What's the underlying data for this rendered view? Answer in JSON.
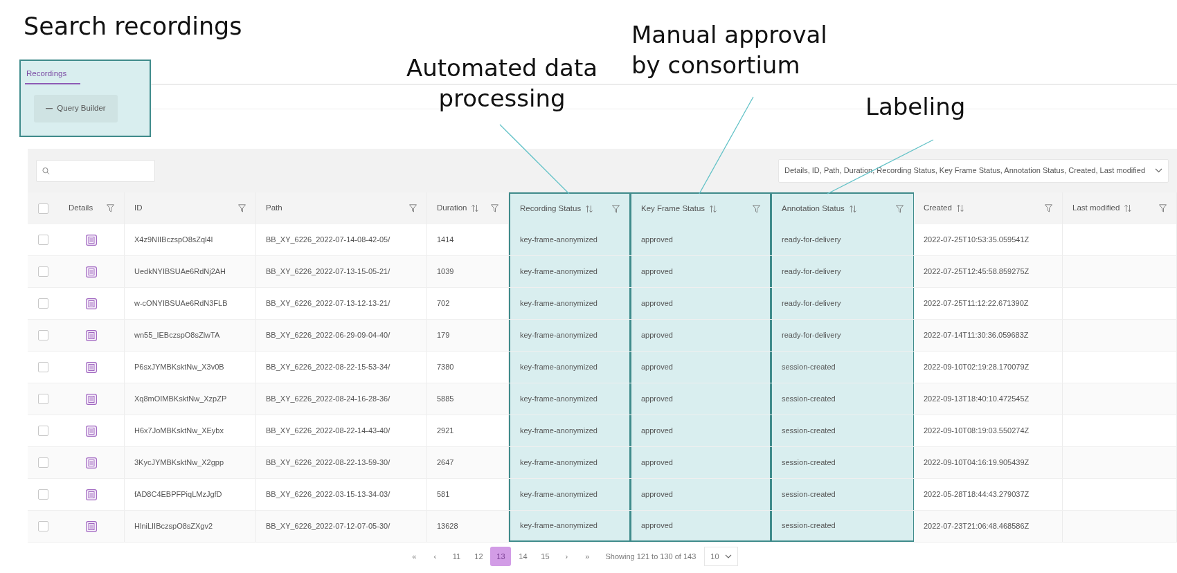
{
  "title": "Search recordings",
  "annotations": [
    "Automated data processing",
    "Manual approval by consortium",
    "Labeling"
  ],
  "tabs": [
    {
      "label": "Recordings",
      "selected": true
    }
  ],
  "query_builder": {
    "label": "Query Builder"
  },
  "column_chooser": {
    "value": "Details, ID, Path, Duration, Recording Status, Key Frame Status, Annotation Status, Created, Last modified"
  },
  "select_all": {
    "checked": false
  },
  "columns": [
    {
      "label": "Details",
      "sortable": false,
      "filterable": true,
      "highlighted": false
    },
    {
      "label": "ID",
      "sortable": false,
      "filterable": true,
      "highlighted": false
    },
    {
      "label": "Path",
      "sortable": false,
      "filterable": true,
      "highlighted": false
    },
    {
      "label": "Duration",
      "sortable": true,
      "filterable": true,
      "highlighted": false
    },
    {
      "label": "Recording Status",
      "sortable": true,
      "filterable": true,
      "highlighted": true
    },
    {
      "label": "Key Frame Status",
      "sortable": true,
      "filterable": true,
      "highlighted": true
    },
    {
      "label": "Annotation Status",
      "sortable": true,
      "filterable": true,
      "highlighted": true
    },
    {
      "label": "Created",
      "sortable": true,
      "filterable": true,
      "highlighted": false
    },
    {
      "label": "Last modified",
      "sortable": true,
      "filterable": true,
      "highlighted": false
    }
  ],
  "rows": [
    {
      "checked": false,
      "id": "X4z9NIIBczspO8sZql4l",
      "path": "BB_XY_6226_2022-07-14-08-42-05/",
      "duration": "1414",
      "recording_status": "key-frame-anonymized",
      "key_frame_status": "approved",
      "annotation_status": "ready-for-delivery",
      "created": "2022-07-25T10:53:35.059541Z"
    },
    {
      "checked": false,
      "id": "UedkNYIBSUAe6RdNj2AH",
      "path": "BB_XY_6226_2022-07-13-15-05-21/",
      "duration": "1039",
      "recording_status": "key-frame-anonymized",
      "key_frame_status": "approved",
      "annotation_status": "ready-for-delivery",
      "created": "2022-07-25T12:45:58.859275Z"
    },
    {
      "checked": false,
      "id": "w-cONYIBSUAe6RdN3FLB",
      "path": "BB_XY_6226_2022-07-13-12-13-21/",
      "duration": "702",
      "recording_status": "key-frame-anonymized",
      "key_frame_status": "approved",
      "annotation_status": "ready-for-delivery",
      "created": "2022-07-25T11:12:22.671390Z"
    },
    {
      "checked": false,
      "id": "wn55_IEBczspO8sZlwTA",
      "path": "BB_XY_6226_2022-06-29-09-04-40/",
      "duration": "179",
      "recording_status": "key-frame-anonymized",
      "key_frame_status": "approved",
      "annotation_status": "ready-for-delivery",
      "created": "2022-07-14T11:30:36.059683Z"
    },
    {
      "checked": false,
      "id": "P6sxJYMBKsktNw_X3v0B",
      "path": "BB_XY_6226_2022-08-22-15-53-34/",
      "duration": "7380",
      "recording_status": "key-frame-anonymized",
      "key_frame_status": "approved",
      "annotation_status": "session-created",
      "created": "2022-09-10T02:19:28.170079Z"
    },
    {
      "checked": false,
      "id": "Xq8mOIMBKsktNw_XzpZP",
      "path": "BB_XY_6226_2022-08-24-16-28-36/",
      "duration": "5885",
      "recording_status": "key-frame-anonymized",
      "key_frame_status": "approved",
      "annotation_status": "session-created",
      "created": "2022-09-13T18:40:10.472545Z"
    },
    {
      "checked": false,
      "id": "H6x7JoMBKsktNw_XEybx",
      "path": "BB_XY_6226_2022-08-22-14-43-40/",
      "duration": "2921",
      "recording_status": "key-frame-anonymized",
      "key_frame_status": "approved",
      "annotation_status": "session-created",
      "created": "2022-09-10T08:19:03.550274Z"
    },
    {
      "checked": false,
      "id": "3KycJYMBKsktNw_X2gpp",
      "path": "BB_XY_6226_2022-08-22-13-59-30/",
      "duration": "2647",
      "recording_status": "key-frame-anonymized",
      "key_frame_status": "approved",
      "annotation_status": "session-created",
      "created": "2022-09-10T04:16:19.905439Z"
    },
    {
      "checked": false,
      "id": "fAD8C4EBPFPiqLMzJgfD",
      "path": "BB_XY_6226_2022-03-15-13-34-03/",
      "duration": "581",
      "recording_status": "key-frame-anonymized",
      "key_frame_status": "approved",
      "annotation_status": "session-created",
      "created": "2022-05-28T18:44:43.279037Z"
    },
    {
      "checked": false,
      "id": "HlniLIIBczspO8sZXgv2",
      "path": "BB_XY_6226_2022-07-12-07-05-30/",
      "duration": "13628",
      "recording_status": "key-frame-anonymized",
      "key_frame_status": "approved",
      "annotation_status": "session-created",
      "created": "2022-07-23T21:06:48.468586Z"
    }
  ],
  "pagination": {
    "first": "«",
    "previous": "‹",
    "pages": [
      {
        "label": "11",
        "selected": false
      },
      {
        "label": "12",
        "selected": false
      },
      {
        "label": "13",
        "selected": true
      },
      {
        "label": "14",
        "selected": false
      },
      {
        "label": "15",
        "selected": false
      }
    ],
    "next": "›",
    "last": "»",
    "summary": "Showing 121 to 130 of 143",
    "page_size": "10"
  }
}
